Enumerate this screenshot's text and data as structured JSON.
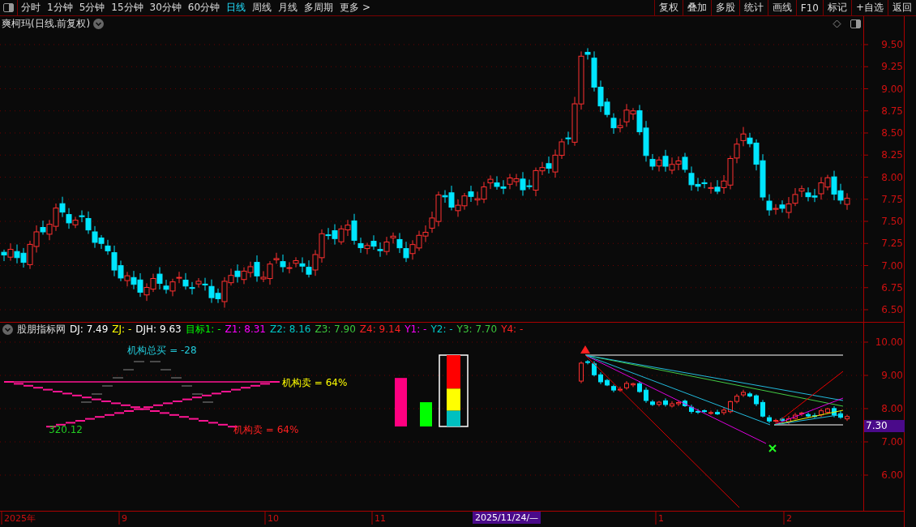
{
  "toolbar": {
    "periods": [
      {
        "label": "分时",
        "selected": false
      },
      {
        "label": "1分钟",
        "selected": false
      },
      {
        "label": "5分钟",
        "selected": false
      },
      {
        "label": "15分钟",
        "selected": false
      },
      {
        "label": "30分钟",
        "selected": false
      },
      {
        "label": "60分钟",
        "selected": false
      },
      {
        "label": "日线",
        "selected": true
      },
      {
        "label": "周线",
        "selected": false
      },
      {
        "label": "月线",
        "selected": false
      },
      {
        "label": "多周期",
        "selected": false
      },
      {
        "label": "更多 >",
        "selected": false
      }
    ],
    "buttons": [
      "复权",
      "叠加",
      "多股",
      "统计",
      "画线",
      "F10",
      "标记",
      "+自选",
      "返回"
    ]
  },
  "main_chart": {
    "title": "爽柯玛(日线.前复权)",
    "price_ticks": [
      "9.50",
      "9.25",
      "9.00",
      "8.75",
      "8.50",
      "8.25",
      "8.00",
      "7.75",
      "7.50",
      "7.25",
      "7.00",
      "6.75",
      "6.50"
    ]
  },
  "indicator": {
    "name": "股朋指标网",
    "values": [
      {
        "text": "DJ: 7.49",
        "color": "#ffffff"
      },
      {
        "text": "ZJ: -",
        "color": "#ffff00"
      },
      {
        "text": "DJH: 9.63",
        "color": "#ffffff"
      },
      {
        "text": "目标1: -",
        "color": "#00ff00"
      },
      {
        "text": "Z1: 8.31",
        "color": "#ff00ff"
      },
      {
        "text": "Z2: 8.16",
        "color": "#00c8c8"
      },
      {
        "text": "Z3: 7.90",
        "color": "#3cc83c"
      },
      {
        "text": "Z4: 9.14",
        "color": "#ff2020"
      },
      {
        "text": "Y1: -",
        "color": "#ff00ff"
      },
      {
        "text": "Y2: -",
        "color": "#00c8c8"
      },
      {
        "text": "Y3: 7.70",
        "color": "#3cc83c"
      },
      {
        "text": "Y4: -",
        "color": "#ff2020"
      }
    ],
    "labels": [
      {
        "kind": "total",
        "text": "机构总买 = -28"
      },
      {
        "kind": "sell_upper",
        "text": "机构卖 = 64%"
      },
      {
        "kind": "value",
        "text": "320.12"
      },
      {
        "kind": "sell_lower",
        "text": "机构卖 = 64%"
      }
    ],
    "bars": [
      {
        "level": 0.68,
        "color": "#ff0080"
      },
      {
        "level": 0.34,
        "color": "#00ff00"
      }
    ],
    "stack": [
      {
        "level": 0.47,
        "color": "#ff0000"
      },
      {
        "level": 0.31,
        "color": "#ffff00"
      },
      {
        "level": 0.22,
        "color": "#00c0c0"
      }
    ],
    "price_ticks": [
      "10.00",
      "9.00",
      "8.00",
      "7.00",
      "6.00"
    ],
    "current_price": "7.30"
  },
  "date_axis": {
    "labels": [
      "2025年",
      "9",
      "10",
      "11",
      "1",
      "2"
    ],
    "cursor": "2025/11/24/—"
  }
}
